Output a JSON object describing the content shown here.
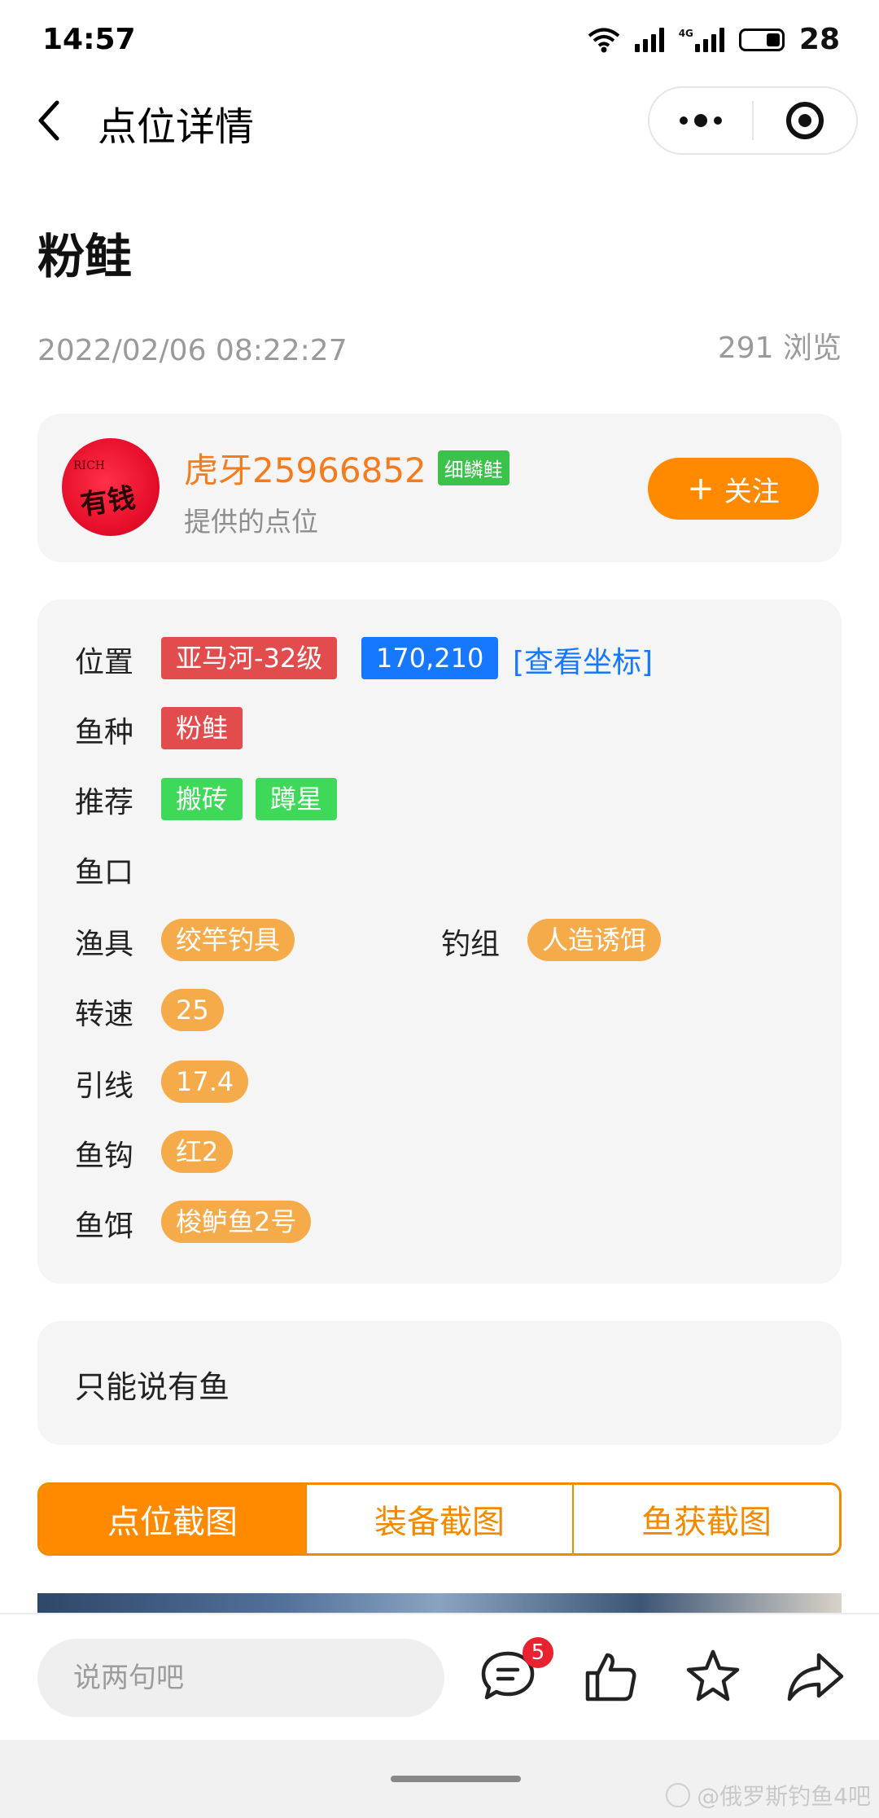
{
  "status_bar": {
    "time": "14:57",
    "network_label": "4G",
    "battery": "28"
  },
  "nav": {
    "title": "点位详情"
  },
  "post": {
    "title": "粉鲑",
    "date": "2022/02/06 08:22:27",
    "views": "291 浏览"
  },
  "author": {
    "name": "虎牙25966852",
    "badge": "细鳞鲑",
    "subtitle": "提供的点位",
    "avatar_text_top": "RICH",
    "avatar_text_main": "有钱",
    "follow_label": "关注"
  },
  "details": {
    "location": {
      "label": "位置",
      "map": "亚马河-32级",
      "coords": "170,210",
      "view_coords": "[查看坐标]"
    },
    "species": {
      "label": "鱼种",
      "value": "粉鲑"
    },
    "recommend": {
      "label": "推荐",
      "tags": [
        "搬砖",
        "蹲星"
      ]
    },
    "bite": {
      "label": "鱼口"
    },
    "tackle": {
      "label": "渔具",
      "value": "绞竿钓具"
    },
    "rig": {
      "label": "钓组",
      "value": "人造诱饵"
    },
    "speed": {
      "label": "转速",
      "value": "25"
    },
    "leader": {
      "label": "引线",
      "value": "17.4"
    },
    "hook": {
      "label": "鱼钩",
      "value": "红2"
    },
    "bait": {
      "label": "鱼饵",
      "value": "梭鲈鱼2号"
    }
  },
  "comment": {
    "text": "只能说有鱼"
  },
  "tabs": [
    {
      "label": "点位截图",
      "active": true
    },
    {
      "label": "装备截图",
      "active": false
    },
    {
      "label": "鱼获截图",
      "active": false
    }
  ],
  "bottom_bar": {
    "input_placeholder": "说两句吧",
    "comment_count": "5"
  },
  "watermark": "@俄罗斯钓鱼4吧",
  "colors": {
    "accent": "#ff8a00",
    "link": "#1677ff",
    "tag_red": "#e24c4c",
    "tag_green": "#3fd95a",
    "tag_orange": "#f5ab4a"
  }
}
